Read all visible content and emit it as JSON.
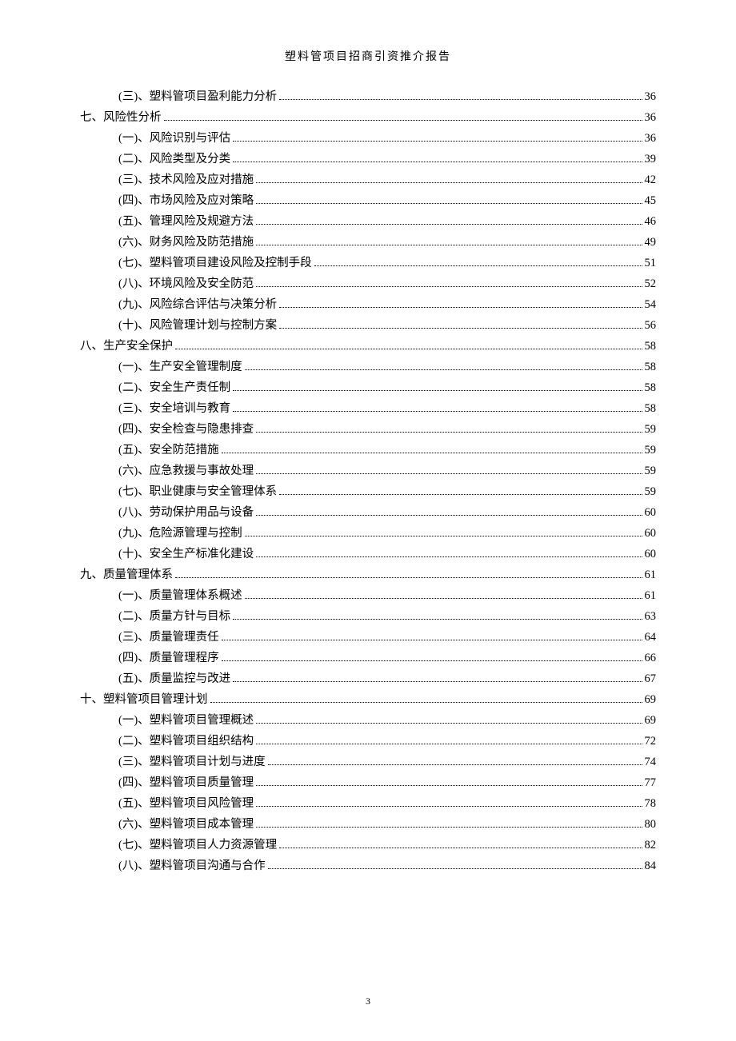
{
  "header": "塑料管项目招商引资推介报告",
  "footer_page": "3",
  "toc": [
    {
      "level": 2,
      "label": "(三)、塑料管项目盈利能力分析",
      "page": "36"
    },
    {
      "level": 1,
      "label": "七、风险性分析",
      "page": "36"
    },
    {
      "level": 2,
      "label": "(一)、风险识别与评估",
      "page": "36"
    },
    {
      "level": 2,
      "label": "(二)、风险类型及分类",
      "page": "39"
    },
    {
      "level": 2,
      "label": "(三)、技术风险及应对措施",
      "page": "42"
    },
    {
      "level": 2,
      "label": "(四)、市场风险及应对策略",
      "page": "45"
    },
    {
      "level": 2,
      "label": "(五)、管理风险及规避方法",
      "page": "46"
    },
    {
      "level": 2,
      "label": "(六)、财务风险及防范措施",
      "page": "49"
    },
    {
      "level": 2,
      "label": "(七)、塑料管项目建设风险及控制手段",
      "page": "51"
    },
    {
      "level": 2,
      "label": "(八)、环境风险及安全防范",
      "page": "52"
    },
    {
      "level": 2,
      "label": "(九)、风险综合评估与决策分析",
      "page": "54"
    },
    {
      "level": 2,
      "label": "(十)、风险管理计划与控制方案",
      "page": "56"
    },
    {
      "level": 1,
      "label": "八、生产安全保护",
      "page": "58"
    },
    {
      "level": 2,
      "label": "(一)、生产安全管理制度",
      "page": "58"
    },
    {
      "level": 2,
      "label": "(二)、安全生产责任制",
      "page": "58"
    },
    {
      "level": 2,
      "label": "(三)、安全培训与教育",
      "page": "58"
    },
    {
      "level": 2,
      "label": "(四)、安全检查与隐患排查",
      "page": "59"
    },
    {
      "level": 2,
      "label": "(五)、安全防范措施",
      "page": "59"
    },
    {
      "level": 2,
      "label": "(六)、应急救援与事故处理",
      "page": "59"
    },
    {
      "level": 2,
      "label": "(七)、职业健康与安全管理体系",
      "page": "59"
    },
    {
      "level": 2,
      "label": "(八)、劳动保护用品与设备",
      "page": "60"
    },
    {
      "level": 2,
      "label": "(九)、危险源管理与控制",
      "page": "60"
    },
    {
      "level": 2,
      "label": "(十)、安全生产标准化建设",
      "page": "60"
    },
    {
      "level": 1,
      "label": "九、质量管理体系",
      "page": "61"
    },
    {
      "level": 2,
      "label": "(一)、质量管理体系概述",
      "page": "61"
    },
    {
      "level": 2,
      "label": "(二)、质量方针与目标",
      "page": "63"
    },
    {
      "level": 2,
      "label": "(三)、质量管理责任",
      "page": "64"
    },
    {
      "level": 2,
      "label": "(四)、质量管理程序",
      "page": "66"
    },
    {
      "level": 2,
      "label": "(五)、质量监控与改进",
      "page": "67"
    },
    {
      "level": 1,
      "label": "十、塑料管项目管理计划",
      "page": "69"
    },
    {
      "level": 2,
      "label": "(一)、塑料管项目管理概述",
      "page": "69"
    },
    {
      "level": 2,
      "label": "(二)、塑料管项目组织结构",
      "page": "72"
    },
    {
      "level": 2,
      "label": "(三)、塑料管项目计划与进度",
      "page": "74"
    },
    {
      "level": 2,
      "label": "(四)、塑料管项目质量管理",
      "page": "77"
    },
    {
      "level": 2,
      "label": "(五)、塑料管项目风险管理",
      "page": "78"
    },
    {
      "level": 2,
      "label": "(六)、塑料管项目成本管理",
      "page": "80"
    },
    {
      "level": 2,
      "label": "(七)、塑料管项目人力资源管理",
      "page": "82"
    },
    {
      "level": 2,
      "label": "(八)、塑料管项目沟通与合作",
      "page": "84"
    }
  ]
}
